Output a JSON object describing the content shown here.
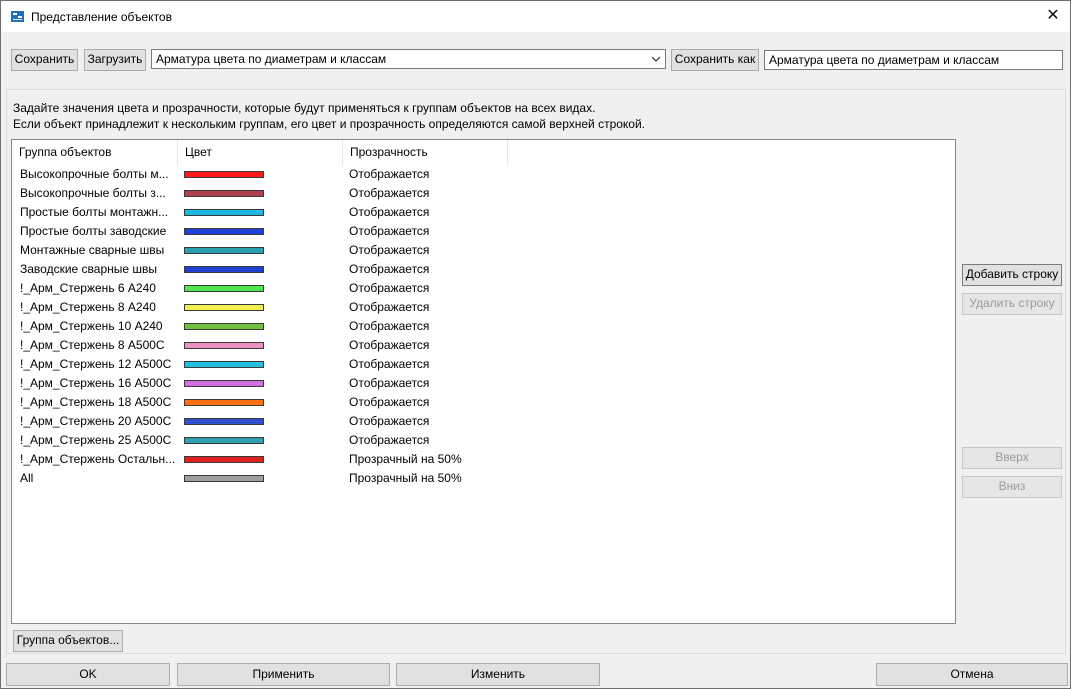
{
  "window": {
    "title": "Представление объектов",
    "close_glyph": "✕"
  },
  "toolbar": {
    "save_label": "Сохранить",
    "load_label": "Загрузить",
    "preset_value": "Арматура цвета по диаметрам и классам",
    "save_as_label": "Сохранить как",
    "save_as_value": "Арматура цвета по диаметрам и классам"
  },
  "description": {
    "line1": "Задайте значения цвета и прозрачности, которые будут применяться к группам объектов на всех видах.",
    "line2": "Если объект принадлежит к нескольким группам, его цвет и прозрачность определяются самой верхней строкой."
  },
  "table": {
    "headers": {
      "group": "Группа объектов",
      "color": "Цвет",
      "transparency": "Прозрачность"
    },
    "rows": [
      {
        "group": "Высокопрочные болты м...",
        "color": "#ff1a1a",
        "transparency": "Отображается"
      },
      {
        "group": "Высокопрочные болты з...",
        "color": "#b04050",
        "transparency": "Отображается"
      },
      {
        "group": "Простые болты монтажн...",
        "color": "#1ab8e0",
        "transparency": "Отображается"
      },
      {
        "group": "Простые болты заводские",
        "color": "#2040d8",
        "transparency": "Отображается"
      },
      {
        "group": "Монтажные сварные швы",
        "color": "#2aa0b0",
        "transparency": "Отображается"
      },
      {
        "group": "Заводские сварные швы",
        "color": "#2040d0",
        "transparency": "Отображается"
      },
      {
        "group": "!_Арм_Стержень 6 А240",
        "color": "#50e850",
        "transparency": "Отображается"
      },
      {
        "group": "!_Арм_Стержень 8 А240",
        "color": "#f0f050",
        "transparency": "Отображается"
      },
      {
        "group": "!_Арм_Стержень 10 А240",
        "color": "#70c040",
        "transparency": "Отображается"
      },
      {
        "group": "!_Арм_Стержень 8 А500С",
        "color": "#f090c0",
        "transparency": "Отображается"
      },
      {
        "group": "!_Арм_Стержень 12 А500С",
        "color": "#20c0e0",
        "transparency": "Отображается"
      },
      {
        "group": "!_Арм_Стержень 16 А500С",
        "color": "#d070e0",
        "transparency": "Отображается"
      },
      {
        "group": "!_Арм_Стержень 18 А500С",
        "color": "#ff7010",
        "transparency": "Отображается"
      },
      {
        "group": "!_Арм_Стержень 20 А500С",
        "color": "#3050d0",
        "transparency": "Отображается"
      },
      {
        "group": "!_Арм_Стержень 25 А500С",
        "color": "#30a0b0",
        "transparency": "Отображается"
      },
      {
        "group": "!_Арм_Стержень Остальн...",
        "color": "#e02020",
        "transparency": "Прозрачный на 50%"
      },
      {
        "group": "All",
        "color": "#a0a0a0",
        "transparency": "Прозрачный на 50%"
      }
    ]
  },
  "side": {
    "add_row_label": "Добавить строку",
    "delete_row_label": "Удалить строку",
    "up_label": "Вверх",
    "down_label": "Вниз"
  },
  "object_group_label": "Группа объектов...",
  "footer": {
    "ok_label": "OK",
    "apply_label": "Применить",
    "modify_label": "Изменить",
    "cancel_label": "Отмена"
  }
}
